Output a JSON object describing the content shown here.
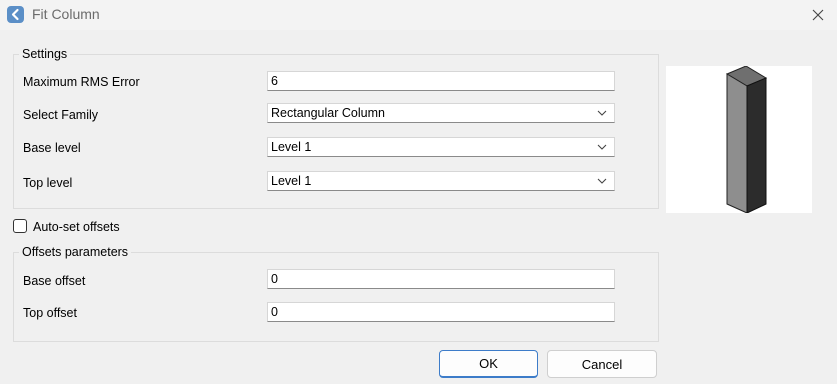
{
  "window": {
    "title": "Fit Column"
  },
  "settings": {
    "legend": "Settings",
    "rms": {
      "label": "Maximum RMS Error",
      "value": "6"
    },
    "family": {
      "label": "Select Family",
      "value": "Rectangular Column"
    },
    "base_level": {
      "label": "Base level",
      "value": "Level 1"
    },
    "top_level": {
      "label": "Top level",
      "value": "Level 1"
    }
  },
  "auto_offsets": {
    "label": "Auto-set offsets",
    "checked": false
  },
  "offsets": {
    "legend": "Offsets parameters",
    "base_offset": {
      "label": "Base offset",
      "value": "0"
    },
    "top_offset": {
      "label": "Top offset",
      "value": "0"
    }
  },
  "buttons": {
    "ok": "OK",
    "cancel": "Cancel"
  },
  "colors": {
    "accent": "#3d7cc9",
    "app_icon": "#5b8fc7"
  },
  "icons": {
    "app": "back-arrow-icon",
    "close": "close-icon",
    "dropdown": "chevron-down-icon"
  }
}
